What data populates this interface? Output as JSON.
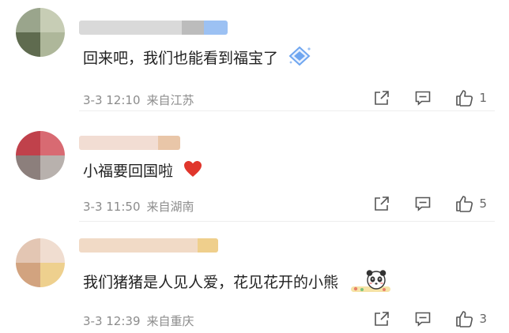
{
  "comments": [
    {
      "text": "回来吧，我们也能看到福宝了",
      "time": "3-3 12:10",
      "location": "来自江苏",
      "likes": "1",
      "trailing_icon": "diamond-badge-icon"
    },
    {
      "text": "小福要回国啦",
      "time": "3-3 11:50",
      "location": "来自湖南",
      "likes": "5",
      "trailing_icon": "red-heart-icon"
    },
    {
      "text": "我们猪猪是人见人爱，花见花开的小熊",
      "time": "3-3 12:39",
      "location": "来自重庆",
      "likes": "3",
      "trailing_icon": "panda-sticker-icon"
    }
  ],
  "icons": {
    "share": "share-icon",
    "reply": "comment-icon",
    "like": "thumbs-up-icon"
  },
  "colors": {
    "meta_text": "#8c8c8c",
    "divider": "#eeeeee",
    "heart": "#e0362c",
    "badge": "#6fa6f0"
  }
}
